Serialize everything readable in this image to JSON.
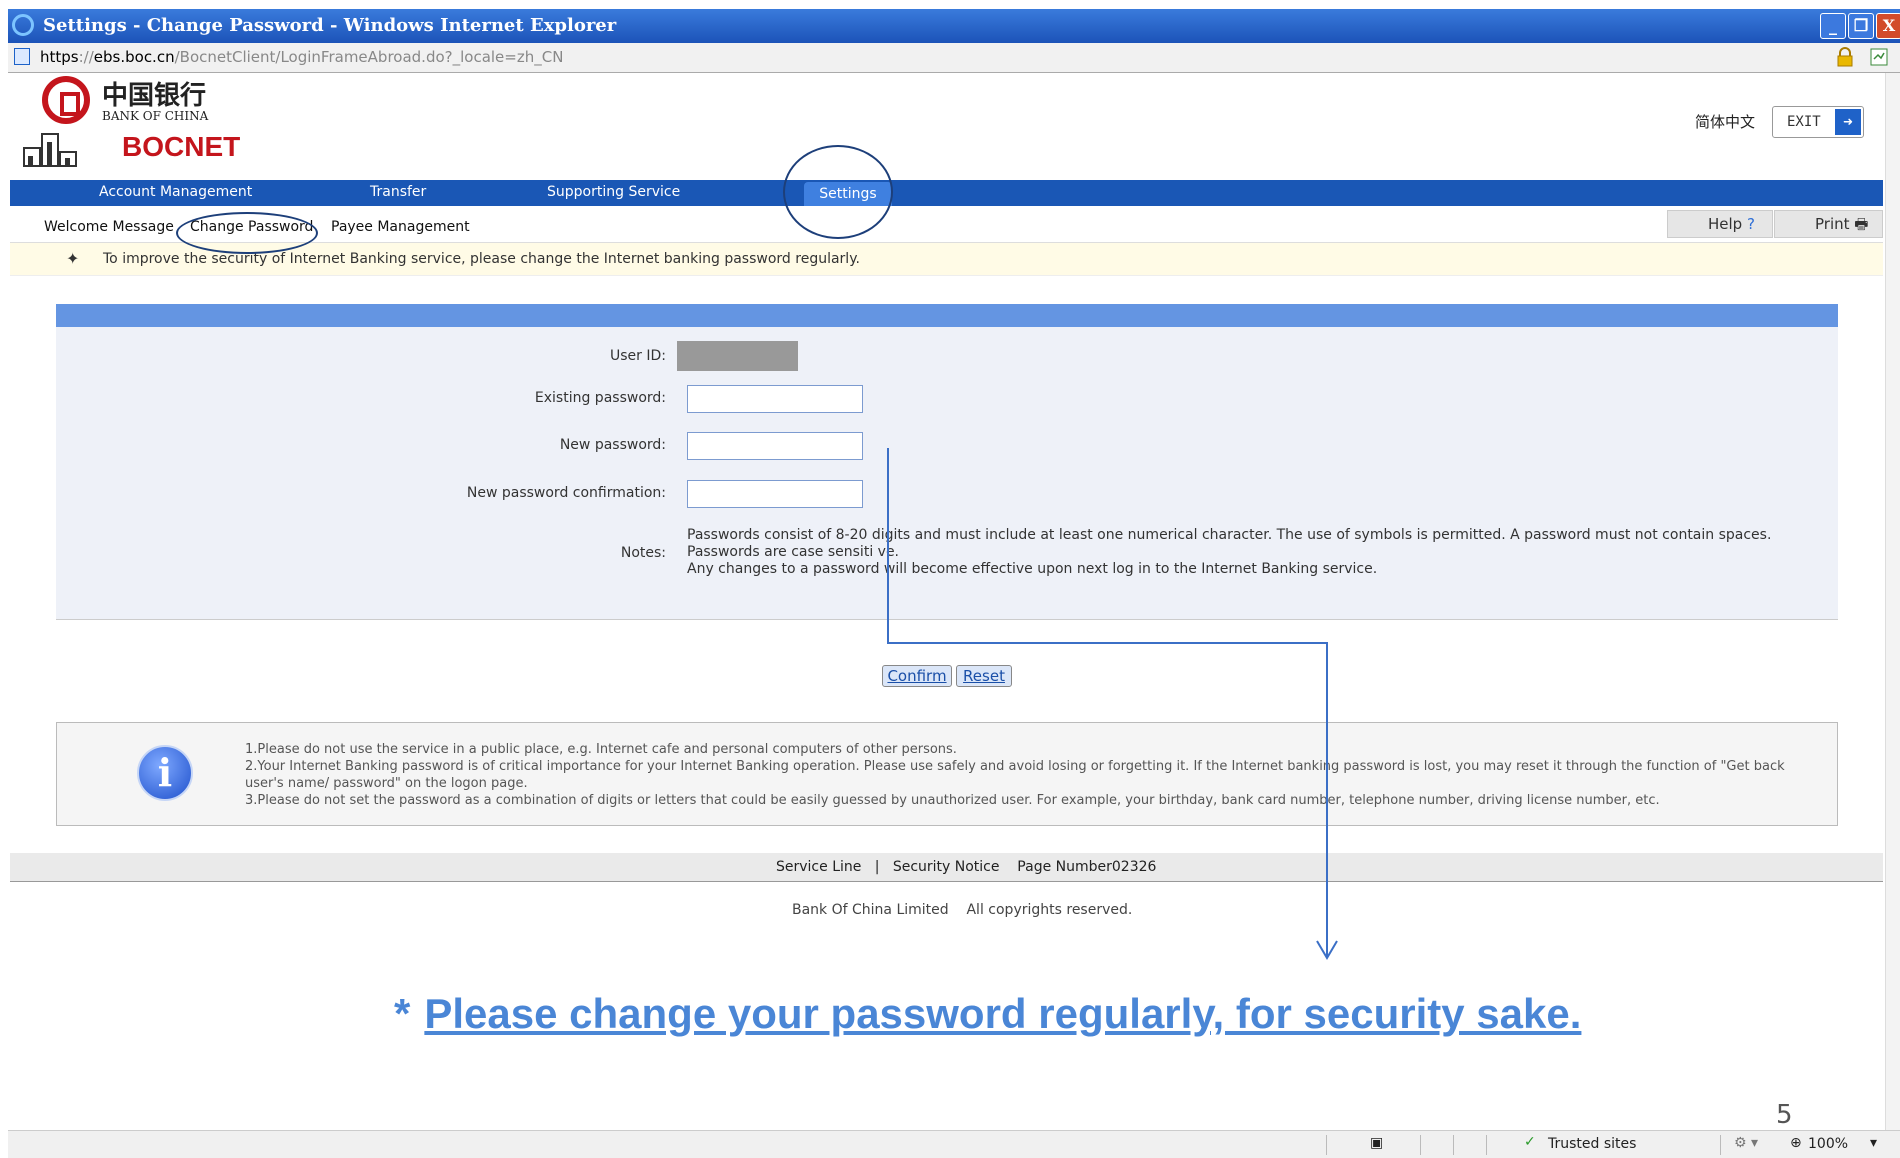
{
  "window": {
    "title": "Settings - Change Password - Windows Internet Explorer",
    "minimize": "_",
    "restore": "❐",
    "close": "X"
  },
  "address": {
    "scheme": "https",
    "sep": "://",
    "host": "ebs.boc.cn",
    "path": "/BocnetClient/LoginFrameAbroad.do?_locale=zh_CN"
  },
  "brand": {
    "chinese_name": "中国银行",
    "english_name": "BANK OF CHINA",
    "product": "BOCNET",
    "red": "#c4151c"
  },
  "header": {
    "language": "简体中文",
    "exit_label": "EXIT"
  },
  "main_nav": {
    "items": [
      "Account Management",
      "Transfer",
      "Supporting Service",
      "Settings"
    ],
    "active": "Settings",
    "bg_color": "#1a57b5"
  },
  "sub_nav": {
    "items": [
      "Welcome Message",
      "Change Password",
      "Payee Management"
    ],
    "active": "Change Password",
    "help_label": "Help",
    "help_icon": "?",
    "print_label": "Print"
  },
  "notice": {
    "text": "To improve the security of Internet Banking service, please change the Internet banking password regularly."
  },
  "form": {
    "user_id_label": "User ID:",
    "existing_label": "Existing password:",
    "new_label": "New password:",
    "confirm_label": "New password confirmation:",
    "notes_label": "Notes:",
    "notes_line1": "Passwords consist of 8-20 digits and must include at least one numerical character. The use of symbols is permitted. A password must not contain spaces. Passwords are case sensiti ve.",
    "notes_line2": "Any changes to a password will become effective upon next log in to the Internet Banking service.",
    "confirm_button": "Confirm",
    "reset_button": "Reset"
  },
  "tips": {
    "line1": "1.Please do not use the service in a public place, e.g. Internet cafe and personal computers of other persons.",
    "line2": "2.Your Internet Banking password is of critical importance for your Internet Banking operation. Please use safely and avoid losing or forgetting it. If the Internet banking password is lost, you may reset it through the function of \"Get back user's name/ password\" on the logon page.",
    "line3": "3.Please do not set the password as a combination of digits or letters that could be easily guessed by unauthorized user. For example, your birthday, bank card number, telephone number, driving license number, etc."
  },
  "footer": {
    "service_line": "Service Line",
    "divider": "|",
    "security_notice": "Security Notice",
    "page_number": "Page Number02326",
    "company": "Bank Of China Limited",
    "rights": "All copyrights reserved."
  },
  "annotation": {
    "star": "*",
    "slogan": "Please change your password regularly, for security sake.",
    "color": "#4a86d6"
  },
  "statusbar": {
    "zone": "Trusted sites",
    "zoom": "100%"
  },
  "slide_page": "5"
}
